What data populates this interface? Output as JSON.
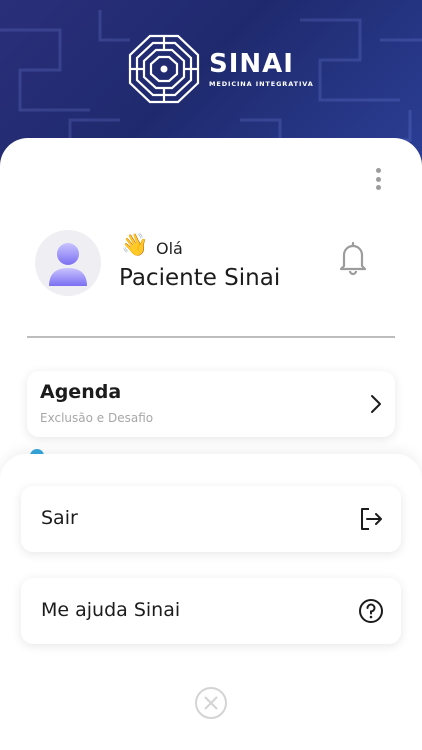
{
  "header": {
    "brand_name": "SINAI",
    "brand_subtitle": "MEDICINA INTEGRATIVA",
    "gradient_start": "#2a2f7a",
    "gradient_end": "#2c3f96"
  },
  "profile": {
    "greeting_emoji": "👋",
    "greeting": "Olá",
    "name": "Paciente Sinai",
    "avatar_icon": "person-avatar-icon",
    "notification_icon": "bell-icon",
    "more_icon": "kebab-menu-icon"
  },
  "agenda": {
    "title": "Agenda",
    "subtitle": "Exclusão e Desafio",
    "chevron_icon": "chevron-right-icon"
  },
  "sheet": {
    "items": [
      {
        "label": "Sair",
        "icon": "logout-icon"
      },
      {
        "label": "Me ajuda Sinai",
        "icon": "help-circle-icon"
      }
    ],
    "close_icon": "close-circle-icon"
  },
  "colors": {
    "accent_blue": "#36a7dd",
    "text_dark": "#1c1c1c",
    "text_muted": "#a7a7a7"
  }
}
